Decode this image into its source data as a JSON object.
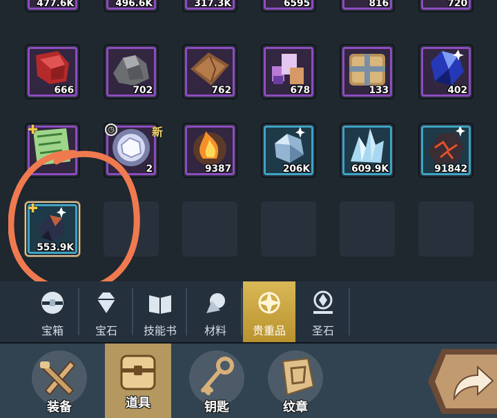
{
  "inventory": {
    "rows": [
      [
        {
          "name": "item-slot",
          "icon": "stacked-item-icon",
          "rarity": "purple",
          "count": "477.6K"
        },
        {
          "name": "item-slot",
          "icon": "stacked-item-icon",
          "rarity": "purple",
          "count": "496.6K"
        },
        {
          "name": "item-slot",
          "icon": "stacked-item-icon",
          "rarity": "purple",
          "count": "317.3K"
        },
        {
          "name": "item-slot",
          "icon": "stacked-item-icon",
          "rarity": "purple",
          "count": "6595"
        },
        {
          "name": "item-slot",
          "icon": "stacked-item-icon",
          "rarity": "purple",
          "count": "816"
        },
        {
          "name": "item-slot",
          "icon": "stacked-item-icon",
          "rarity": "purple",
          "count": "720"
        }
      ],
      [
        {
          "name": "item-slot",
          "icon": "red-cloth-icon",
          "rarity": "purple",
          "count": "666"
        },
        {
          "name": "item-slot",
          "icon": "grey-ore-icon",
          "rarity": "purple",
          "count": "702"
        },
        {
          "name": "item-slot",
          "icon": "leather-icon",
          "rarity": "purple",
          "count": "762"
        },
        {
          "name": "item-slot",
          "icon": "purple-crystals-icon",
          "rarity": "purple",
          "count": "678"
        },
        {
          "name": "item-slot",
          "icon": "wooden-crate-icon",
          "rarity": "purple",
          "count": "133"
        },
        {
          "name": "item-slot",
          "icon": "blue-gem-icon",
          "rarity": "purple",
          "count": "402"
        }
      ],
      [
        {
          "name": "item-slot",
          "icon": "green-scroll-icon",
          "rarity": "purple",
          "count": "",
          "star": true
        },
        {
          "name": "item-slot",
          "icon": "white-sigil-icon",
          "rarity": "purple",
          "count": "2",
          "timed": true,
          "new_label": "新"
        },
        {
          "name": "item-slot",
          "icon": "fire-essence-icon",
          "rarity": "purple",
          "count": "9387"
        },
        {
          "name": "item-slot",
          "icon": "blue-stone-icon",
          "rarity": "blue",
          "count": "206K"
        },
        {
          "name": "item-slot",
          "icon": "ice-crystal-icon",
          "rarity": "blue",
          "count": "609.9K"
        },
        {
          "name": "item-slot",
          "icon": "lava-rock-icon",
          "rarity": "blue",
          "count": "91842"
        }
      ],
      [
        {
          "name": "item-slot",
          "icon": "dark-ore-icon",
          "rarity": "blue",
          "count": "553.9K",
          "star": true,
          "selected": true
        },
        {
          "empty": true
        },
        {
          "empty": true
        },
        {
          "empty": true
        },
        {
          "empty": true
        },
        {
          "empty": true
        }
      ]
    ]
  },
  "subtabs": [
    {
      "label": "宝箱",
      "icon": "chest-icon",
      "active": false
    },
    {
      "label": "宝石",
      "icon": "gem-icon",
      "active": false
    },
    {
      "label": "技能书",
      "icon": "book-icon",
      "active": false
    },
    {
      "label": "材料",
      "icon": "material-icon",
      "active": false
    },
    {
      "label": "贵重品",
      "icon": "valuable-star-icon",
      "active": true
    },
    {
      "label": "圣石",
      "icon": "holy-stone-icon",
      "active": false
    }
  ],
  "bottom_nav": [
    {
      "label": "装备",
      "icon": "equipment-icon",
      "active": false
    },
    {
      "label": "道具",
      "icon": "items-chest-icon",
      "active": true
    },
    {
      "label": "钥匙",
      "icon": "key-icon",
      "active": false
    },
    {
      "label": "纹章",
      "icon": "emblem-icon",
      "active": false
    }
  ],
  "colors": {
    "purple_frame": "#8d4dc0",
    "blue_frame": "#3ea4c4",
    "active_gold": "#d9b856",
    "annotation_orange": "#f07a4f"
  }
}
